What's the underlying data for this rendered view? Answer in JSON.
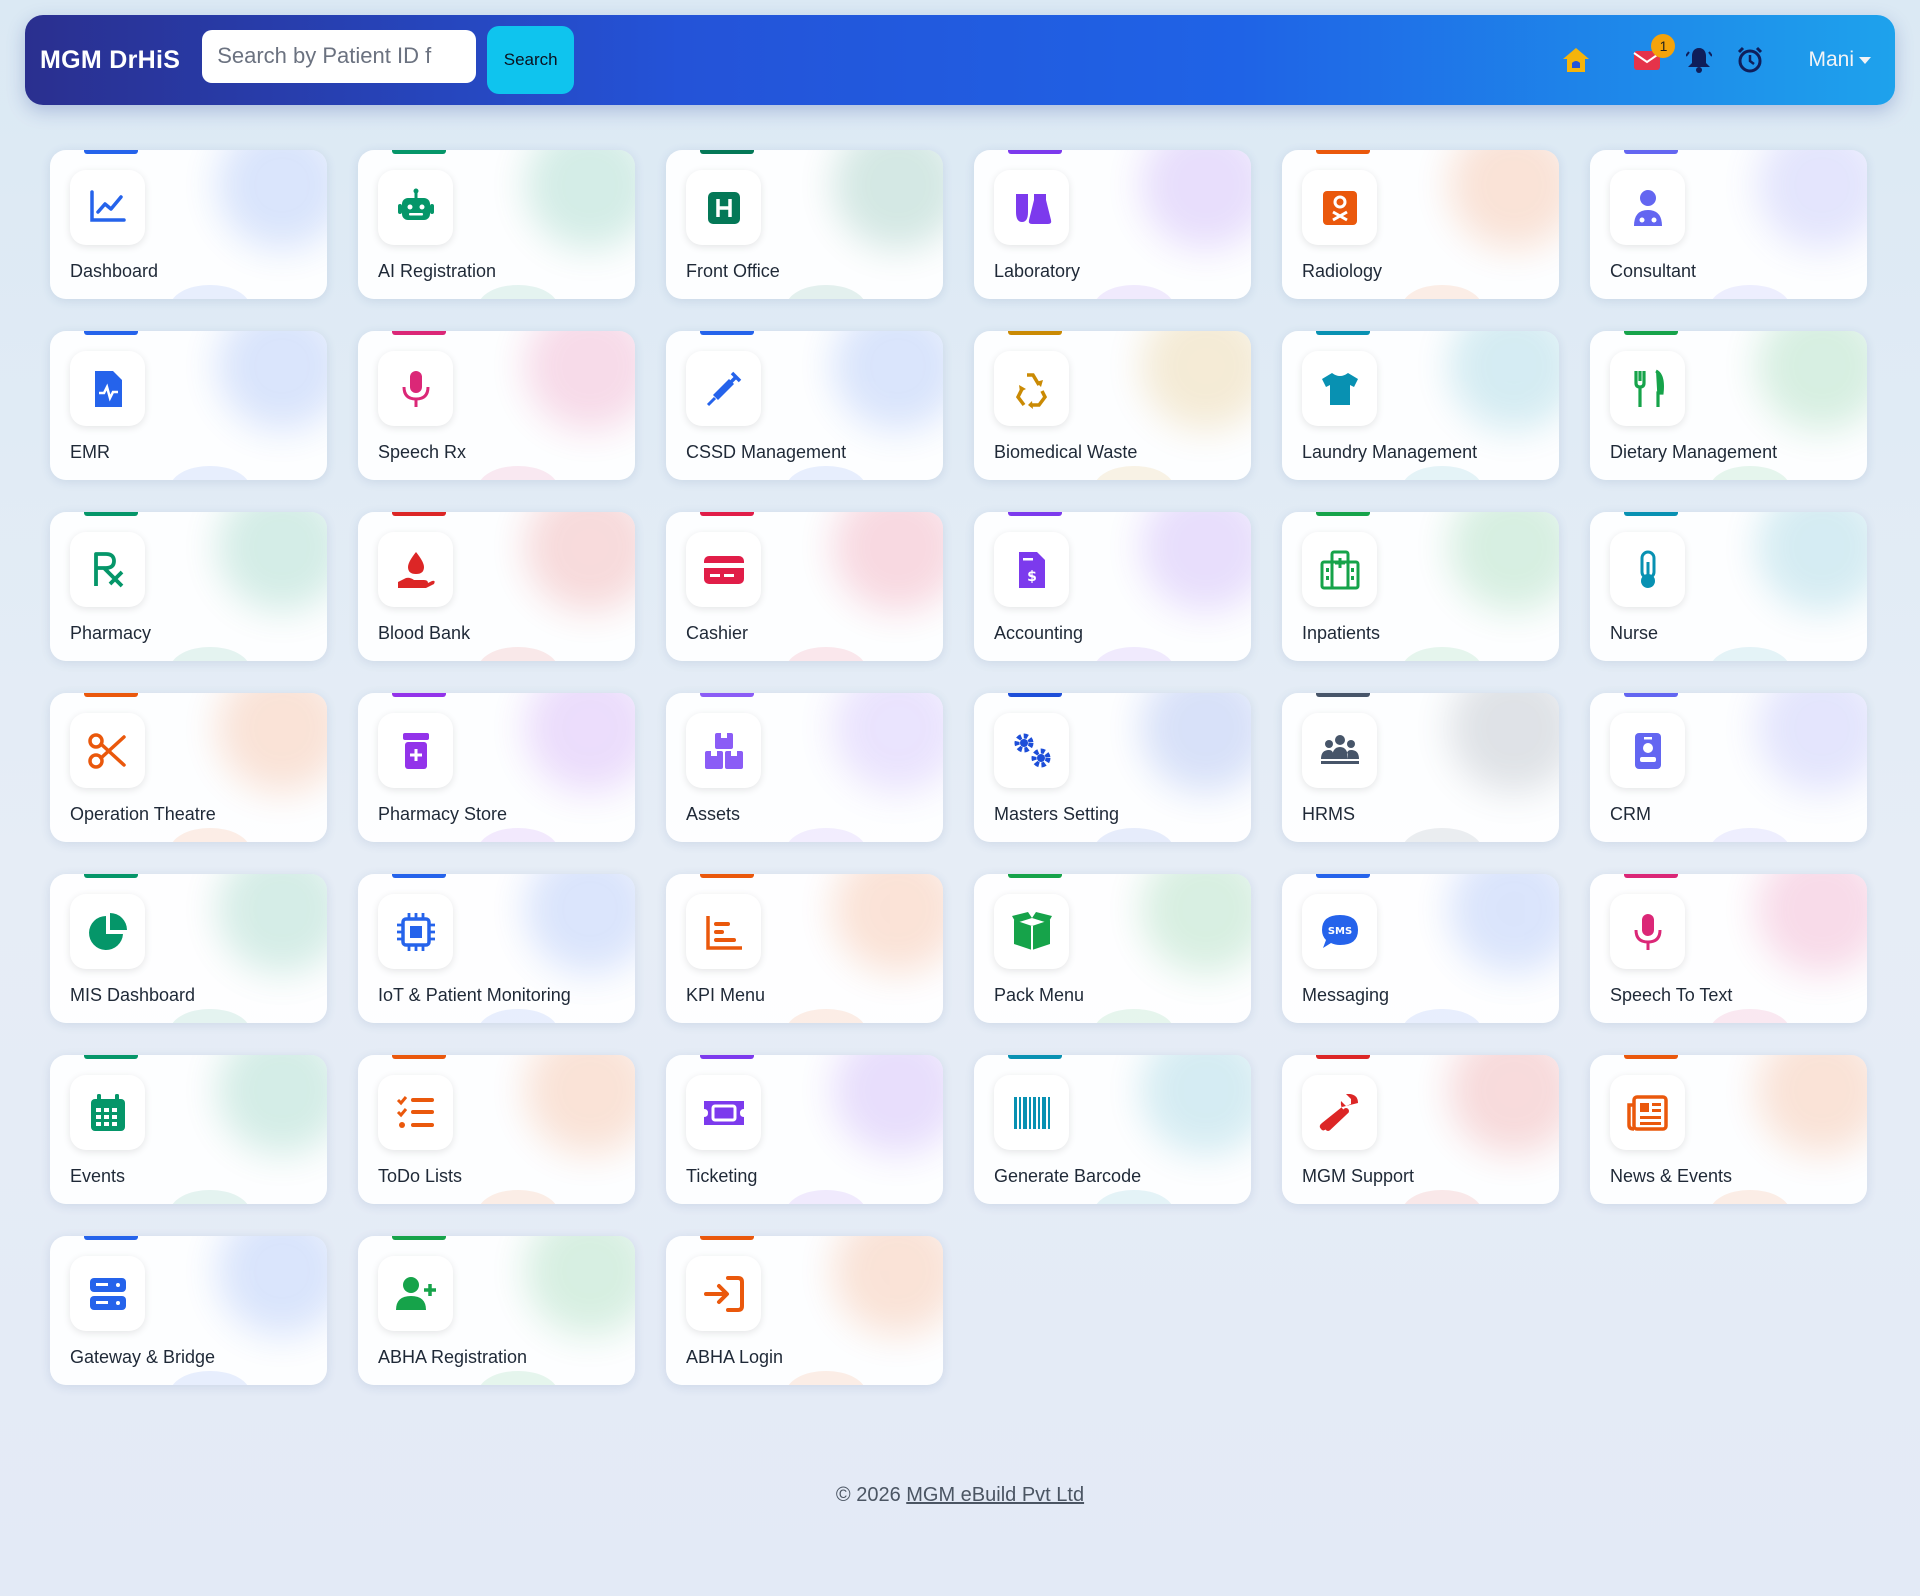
{
  "app": {
    "brand": "MGM DrHiS",
    "search_placeholder": "Search by Patient ID f",
    "search_button": "Search",
    "message_badge": "1",
    "user_name": "Mani"
  },
  "modules": [
    {
      "label": "Dashboard",
      "color": "#2563eb",
      "icon": "chart-line-icon"
    },
    {
      "label": "AI Registration",
      "color": "#059669",
      "icon": "robot-icon"
    },
    {
      "label": "Front Office",
      "color": "#047857",
      "icon": "hospital-h-icon"
    },
    {
      "label": "Laboratory",
      "color": "#7c3aed",
      "icon": "flask-icon"
    },
    {
      "label": "Radiology",
      "color": "#ea580c",
      "icon": "xray-icon"
    },
    {
      "label": "Consultant",
      "color": "#6366f1",
      "icon": "doctor-icon"
    },
    {
      "label": "EMR",
      "color": "#2563eb",
      "icon": "medical-file-icon"
    },
    {
      "label": "Speech Rx",
      "color": "#db2777",
      "icon": "microphone-icon"
    },
    {
      "label": "CSSD Management",
      "color": "#2563eb",
      "icon": "syringe-icon"
    },
    {
      "label": "Biomedical Waste",
      "color": "#ca8a04",
      "icon": "recycle-icon"
    },
    {
      "label": "Laundry Management",
      "color": "#0891b2",
      "icon": "shirt-icon"
    },
    {
      "label": "Dietary Management",
      "color": "#16a34a",
      "icon": "utensils-icon"
    },
    {
      "label": "Pharmacy",
      "color": "#059669",
      "icon": "prescription-icon"
    },
    {
      "label": "Blood Bank",
      "color": "#dc2626",
      "icon": "blood-drop-hand-icon"
    },
    {
      "label": "Cashier",
      "color": "#e11d48",
      "icon": "credit-card-icon"
    },
    {
      "label": "Accounting",
      "color": "#7c3aed",
      "icon": "invoice-dollar-icon"
    },
    {
      "label": "Inpatients",
      "color": "#16a34a",
      "icon": "hospital-building-icon"
    },
    {
      "label": "Nurse",
      "color": "#0891b2",
      "icon": "thermometer-icon"
    },
    {
      "label": "Operation Theatre",
      "color": "#ea580c",
      "icon": "scissors-icon"
    },
    {
      "label": "Pharmacy Store",
      "color": "#9333ea",
      "icon": "pill-bottle-icon"
    },
    {
      "label": "Assets",
      "color": "#8b5cf6",
      "icon": "boxes-icon"
    },
    {
      "label": "Masters Setting",
      "color": "#1d4ed8",
      "icon": "gears-icon"
    },
    {
      "label": "HRMS",
      "color": "#475569",
      "icon": "people-group-icon"
    },
    {
      "label": "CRM",
      "color": "#6366f1",
      "icon": "id-badge-icon"
    },
    {
      "label": "MIS Dashboard",
      "color": "#059669",
      "icon": "pie-chart-icon"
    },
    {
      "label": "IoT & Patient Monitoring",
      "color": "#2563eb",
      "icon": "microchip-icon"
    },
    {
      "label": "KPI Menu",
      "color": "#ea580c",
      "icon": "bar-chart-icon"
    },
    {
      "label": "Pack Menu",
      "color": "#16a34a",
      "icon": "open-box-icon"
    },
    {
      "label": "Messaging",
      "color": "#2563eb",
      "icon": "sms-icon"
    },
    {
      "label": "Speech To Text",
      "color": "#db2777",
      "icon": "microphone-icon"
    },
    {
      "label": "Events",
      "color": "#059669",
      "icon": "calendar-icon"
    },
    {
      "label": "ToDo Lists",
      "color": "#ea580c",
      "icon": "checklist-icon"
    },
    {
      "label": "Ticketing",
      "color": "#7c3aed",
      "icon": "ticket-icon"
    },
    {
      "label": "Generate Barcode",
      "color": "#0891b2",
      "icon": "barcode-icon"
    },
    {
      "label": "MGM Support",
      "color": "#dc2626",
      "icon": "wrench-icon"
    },
    {
      "label": "News & Events",
      "color": "#ea580c",
      "icon": "newspaper-icon"
    },
    {
      "label": "Gateway & Bridge",
      "color": "#2563eb",
      "icon": "server-icon"
    },
    {
      "label": "ABHA Registration",
      "color": "#16a34a",
      "icon": "user-plus-icon"
    },
    {
      "label": "ABHA Login",
      "color": "#ea580c",
      "icon": "sign-in-icon"
    }
  ],
  "footer": {
    "copyright": "© 2026 ",
    "company": "MGM eBuild Pvt Ltd"
  }
}
